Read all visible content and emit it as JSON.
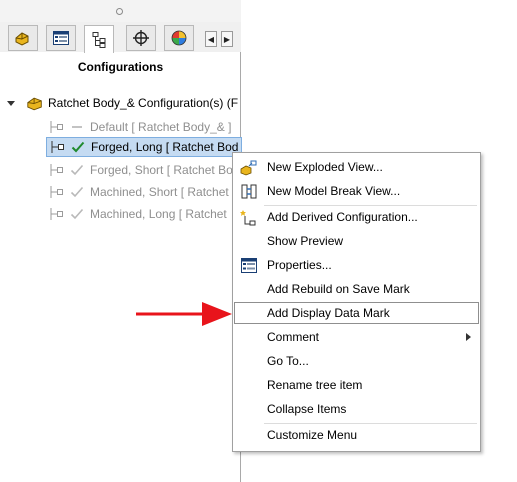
{
  "panel": {
    "title": "Configurations",
    "tabs": [
      {
        "name": "feature-manager-tab-icon"
      },
      {
        "name": "property-manager-tab-icon"
      },
      {
        "name": "configuration-manager-tab-icon"
      },
      {
        "name": "dim-xpert-tab-icon"
      },
      {
        "name": "display-manager-tab-icon"
      }
    ]
  },
  "tree": {
    "root": "Ratchet Body_& Configuration(s)  (F",
    "items": [
      {
        "label": "Default [ Ratchet Body_& ]",
        "state": "inactive"
      },
      {
        "label": "Forged, Long [ Ratchet Bod",
        "state": "active"
      },
      {
        "label": "Forged, Short [ Ratchet Bo",
        "state": "inactive"
      },
      {
        "label": "Machined, Short [ Ratchet",
        "state": "inactive"
      },
      {
        "label": "Machined, Long [ Ratchet",
        "state": "inactive"
      }
    ]
  },
  "context_menu": {
    "items": [
      {
        "label": "New Exploded View...",
        "icon": "exploded-view-icon"
      },
      {
        "label": "New Model Break View...",
        "icon": "model-break-icon"
      },
      {
        "label": "Add Derived Configuration...",
        "icon": "derived-config-icon"
      },
      {
        "label": "Show Preview"
      },
      {
        "label": "Properties...",
        "icon": "properties-icon"
      },
      {
        "label": "Add Rebuild on Save Mark"
      },
      {
        "label": "Add Display Data Mark"
      },
      {
        "label": "Comment"
      },
      {
        "label": "Go To..."
      },
      {
        "label": "Rename tree item"
      },
      {
        "label": "Collapse Items"
      },
      {
        "label": "Customize Menu"
      }
    ],
    "highlighted": "Add Display Data Mark"
  },
  "annotation": {
    "arrow_color": "#e8141b"
  }
}
